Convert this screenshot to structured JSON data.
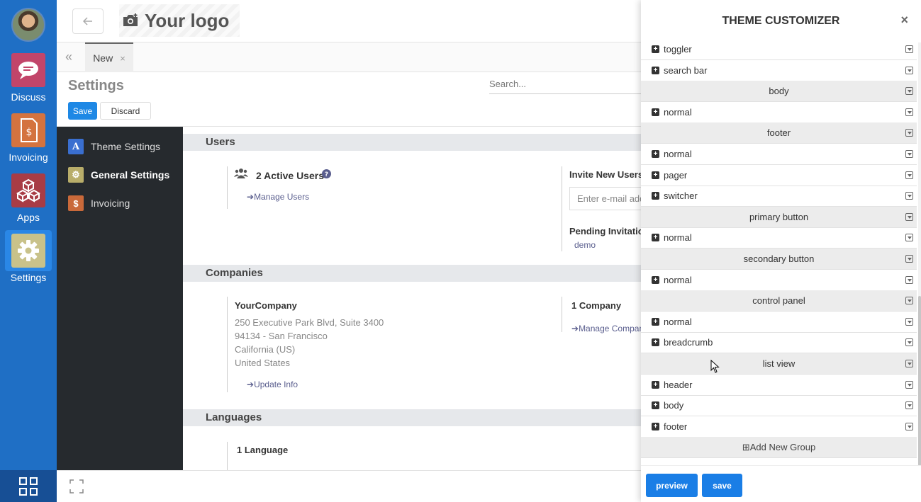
{
  "apps": [
    {
      "label": "Discuss",
      "icon": "chat-bubble-icon",
      "color": "#c2456a"
    },
    {
      "label": "Invoicing",
      "icon": "invoice-icon",
      "color": "#d4733f"
    },
    {
      "label": "Apps",
      "icon": "cubes-icon",
      "color": "#a83c45"
    },
    {
      "label": "Settings",
      "icon": "gear-icon",
      "color": "#c9c28a"
    }
  ],
  "topbar": {
    "logo_text": "Your logo"
  },
  "tabs": [
    {
      "label": "New",
      "close": "×"
    }
  ],
  "control_panel": {
    "title": "Settings",
    "search_placeholder": "Search...",
    "save_label": "Save",
    "discard_label": "Discard"
  },
  "settings_nav": [
    {
      "label": "Theme Settings",
      "icon_text": "A",
      "color": "#3a6fd0"
    },
    {
      "label": "General Settings",
      "icon_text": "⚙",
      "color": "#b8ad6a"
    },
    {
      "label": "Invoicing",
      "icon_text": "$",
      "color": "#c9693a"
    }
  ],
  "sections": {
    "users": {
      "heading": "Users",
      "active_users": "2 Active Users",
      "manage_users": "Manage Users",
      "invite_title": "Invite New Users",
      "invite_placeholder": "Enter e-mail address",
      "pending_title": "Pending Invitations:",
      "pending_user": "demo"
    },
    "companies": {
      "heading": "Companies",
      "company_name": "YourCompany",
      "address": [
        "250 Executive Park Blvd, Suite 3400",
        "94134 - San Francisco",
        "California (US)",
        "United States"
      ],
      "update_info": "Update Info",
      "count": "1 Company",
      "manage_companies": "Manage Companies"
    },
    "languages": {
      "heading": "Languages",
      "count": "1 Language"
    }
  },
  "customizer": {
    "title": "THEME CUSTOMIZER",
    "close": "×",
    "rows": [
      {
        "type": "item",
        "label": "toggler"
      },
      {
        "type": "item",
        "label": "search bar"
      },
      {
        "type": "group",
        "label": "body"
      },
      {
        "type": "item",
        "label": "normal"
      },
      {
        "type": "group",
        "label": "footer"
      },
      {
        "type": "item",
        "label": "normal"
      },
      {
        "type": "item",
        "label": "pager"
      },
      {
        "type": "item",
        "label": "switcher"
      },
      {
        "type": "group",
        "label": "primary button"
      },
      {
        "type": "item",
        "label": "normal"
      },
      {
        "type": "group",
        "label": "secondary button"
      },
      {
        "type": "item",
        "label": "normal"
      },
      {
        "type": "group",
        "label": "control panel"
      },
      {
        "type": "item",
        "label": "normal"
      },
      {
        "type": "item",
        "label": "breadcrumb"
      },
      {
        "type": "group",
        "label": "list view"
      },
      {
        "type": "item",
        "label": "header"
      },
      {
        "type": "item",
        "label": "body"
      },
      {
        "type": "item",
        "label": "footer"
      }
    ],
    "add_group": "Add New Group",
    "preview_label": "preview",
    "save_label": "save",
    "accent": "#1a7ee6"
  }
}
